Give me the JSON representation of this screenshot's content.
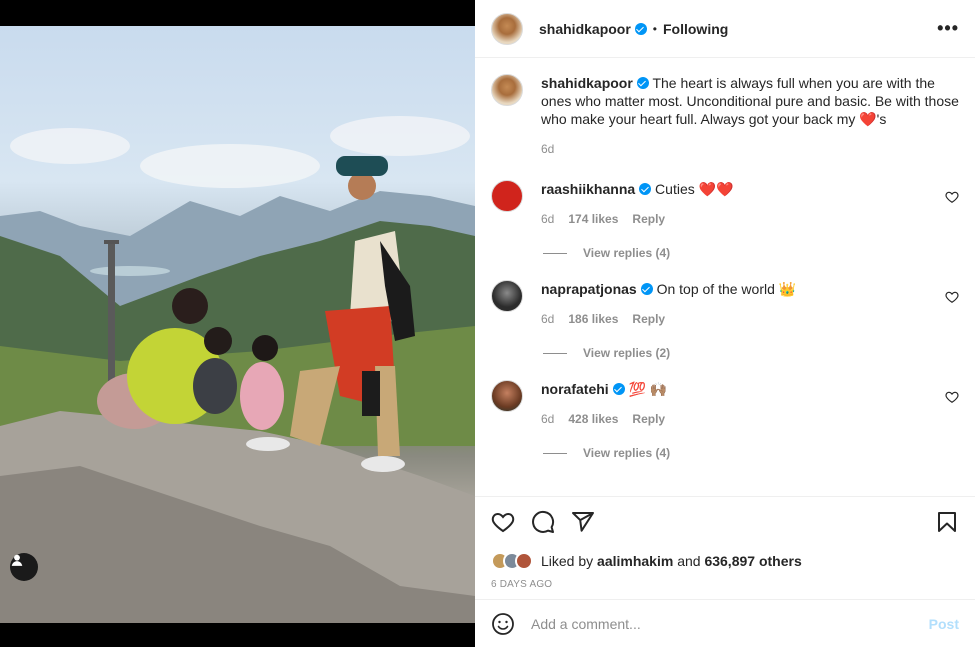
{
  "post": {
    "author": "shahidkapoor",
    "follow_status": "Following",
    "dot": "•",
    "more_label": "•••"
  },
  "caption": {
    "username": "shahidkapoor",
    "text": "The heart is always full when you are with the ones who matter most. Unconditional pure and basic. Be with those who make your heart full. Always got your back my ❤️'s",
    "time": "6d"
  },
  "comments": [
    {
      "username": "raashiikhanna",
      "text": "Cuties ❤️❤️",
      "time": "6d",
      "likes": "174 likes",
      "reply": "Reply",
      "view_replies": "View replies (4)",
      "avatar_color": "#d0241c"
    },
    {
      "username": "naprapatjonas",
      "text": "On top of the world 👑",
      "time": "6d",
      "likes": "186 likes",
      "reply": "Reply",
      "view_replies": "View replies (2)",
      "avatar_color": "#3a3a3a"
    },
    {
      "username": "norafatehi",
      "text": "💯 🙌🏽",
      "time": "6d",
      "likes": "428 likes",
      "reply": "Reply",
      "view_replies": "View replies (4)",
      "avatar_color": "#8e5a3c"
    }
  ],
  "likes": {
    "prefix": "Liked by",
    "user": "aalimhakim",
    "middle": "and",
    "count": "636,897 others"
  },
  "timestamp": "6 DAYS AGO",
  "add_comment": {
    "placeholder": "Add a comment...",
    "post_label": "Post"
  },
  "colors": {
    "verified": "#0095f6",
    "post_button_disabled": "#b2dffc",
    "secondary_text": "#8e8e8e"
  },
  "icons": [
    "heart-icon",
    "comment-icon",
    "share-icon",
    "bookmark-icon",
    "smile-icon",
    "user-tag-icon",
    "more-icon",
    "verified-badge-icon"
  ]
}
